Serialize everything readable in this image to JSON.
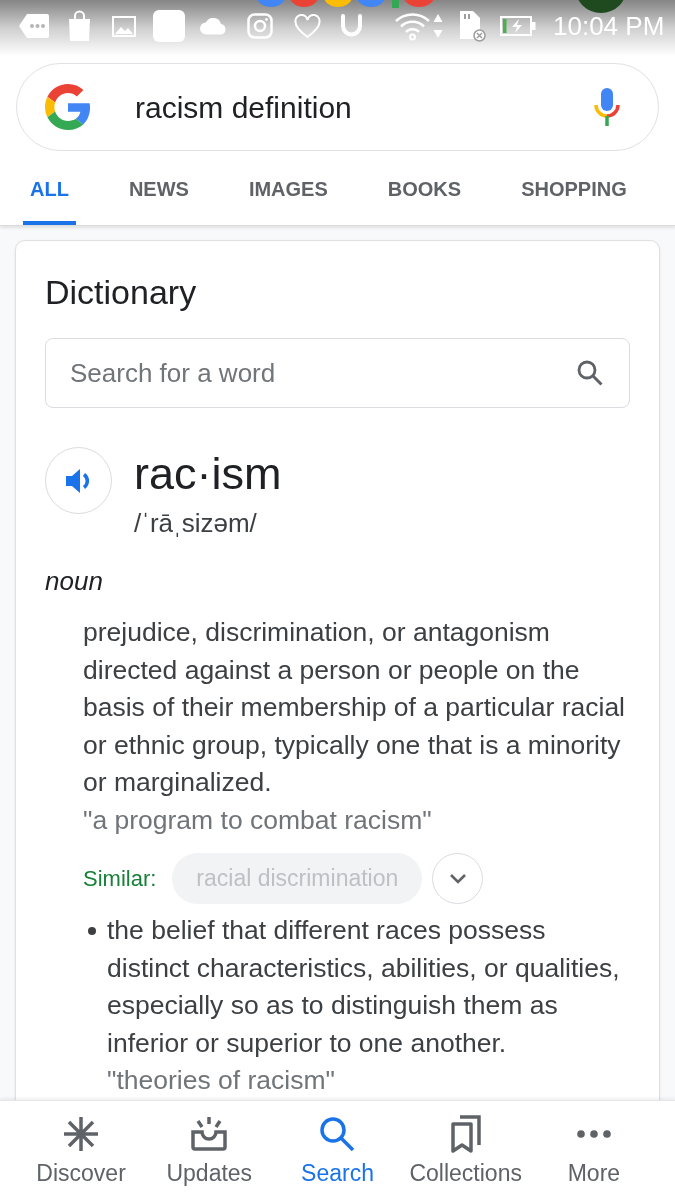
{
  "status_bar": {
    "time": "10:04 PM"
  },
  "search_bar": {
    "query": "racism definition"
  },
  "tabs": [
    {
      "label": "ALL",
      "selected": true
    },
    {
      "label": "NEWS",
      "selected": false
    },
    {
      "label": "IMAGES",
      "selected": false
    },
    {
      "label": "BOOKS",
      "selected": false
    },
    {
      "label": "SHOPPING",
      "selected": false
    }
  ],
  "dictionary": {
    "title": "Dictionary",
    "search": {
      "placeholder": "Search for a word"
    },
    "word": "rac·ism",
    "pronunciation": "/ˈrāˌsizəm/",
    "part_of_speech": "noun",
    "senses": [
      {
        "kind": "plain",
        "definition": "prejudice, discrimination, or antagonism directed against a person or people on the basis of their membership of a particular racial or ethnic group, typically one that is a minority or marginalized.",
        "example": "\"a program to combat racism\"",
        "similar": {
          "label": "Similar:",
          "chips": [
            "racial discrimination"
          ],
          "expanded": false
        }
      },
      {
        "kind": "bulleted",
        "definition": "the belief that different races possess distinct characteristics, abilities, or qualities, especially so as to distinguish them as inferior or superior to one another.",
        "example": "\"theories of racism\""
      }
    ]
  },
  "bottom_nav": [
    {
      "label": "Discover",
      "selected": false
    },
    {
      "label": "Updates",
      "selected": false
    },
    {
      "label": "Search",
      "selected": true
    },
    {
      "label": "Collections",
      "selected": false
    },
    {
      "label": "More",
      "selected": false
    }
  ]
}
